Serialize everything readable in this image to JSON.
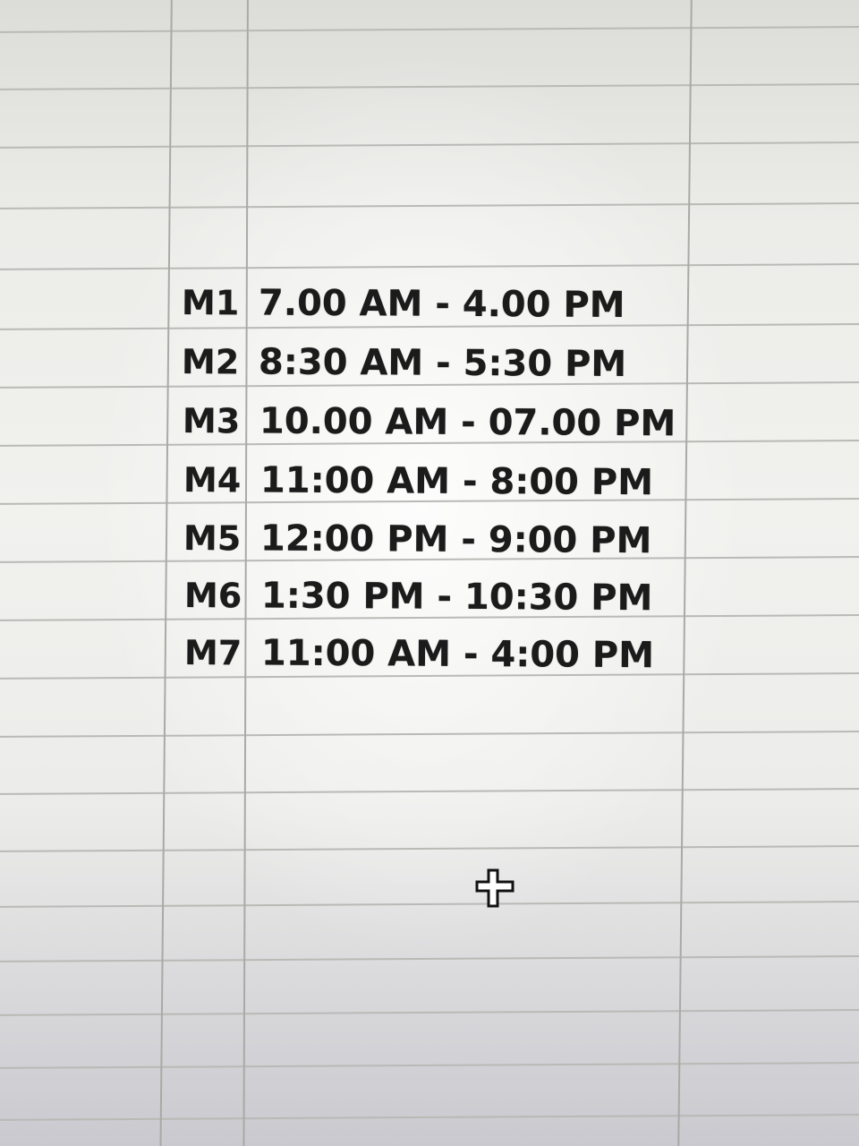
{
  "spreadsheet": {
    "rows": [
      {
        "id": "M1",
        "time": "7.00 AM - 4.00 PM"
      },
      {
        "id": "M2",
        "time": "8:30 AM - 5:30 PM"
      },
      {
        "id": "M3",
        "time": "10.00 AM - 07.00 PM"
      },
      {
        "id": "M4",
        "time": "11:00 AM - 8:00 PM"
      },
      {
        "id": "M5",
        "time": "12:00 PM - 9:00 PM"
      },
      {
        "id": "M6",
        "time": "1:30 PM - 10:30 PM"
      },
      {
        "id": "M7",
        "time": "11:00 AM - 4:00 PM"
      }
    ]
  },
  "cursor": {
    "icon": "crosshair-plus-icon"
  },
  "colors": {
    "gridline": "#b9b9b6",
    "text": "#1b1b1b"
  }
}
